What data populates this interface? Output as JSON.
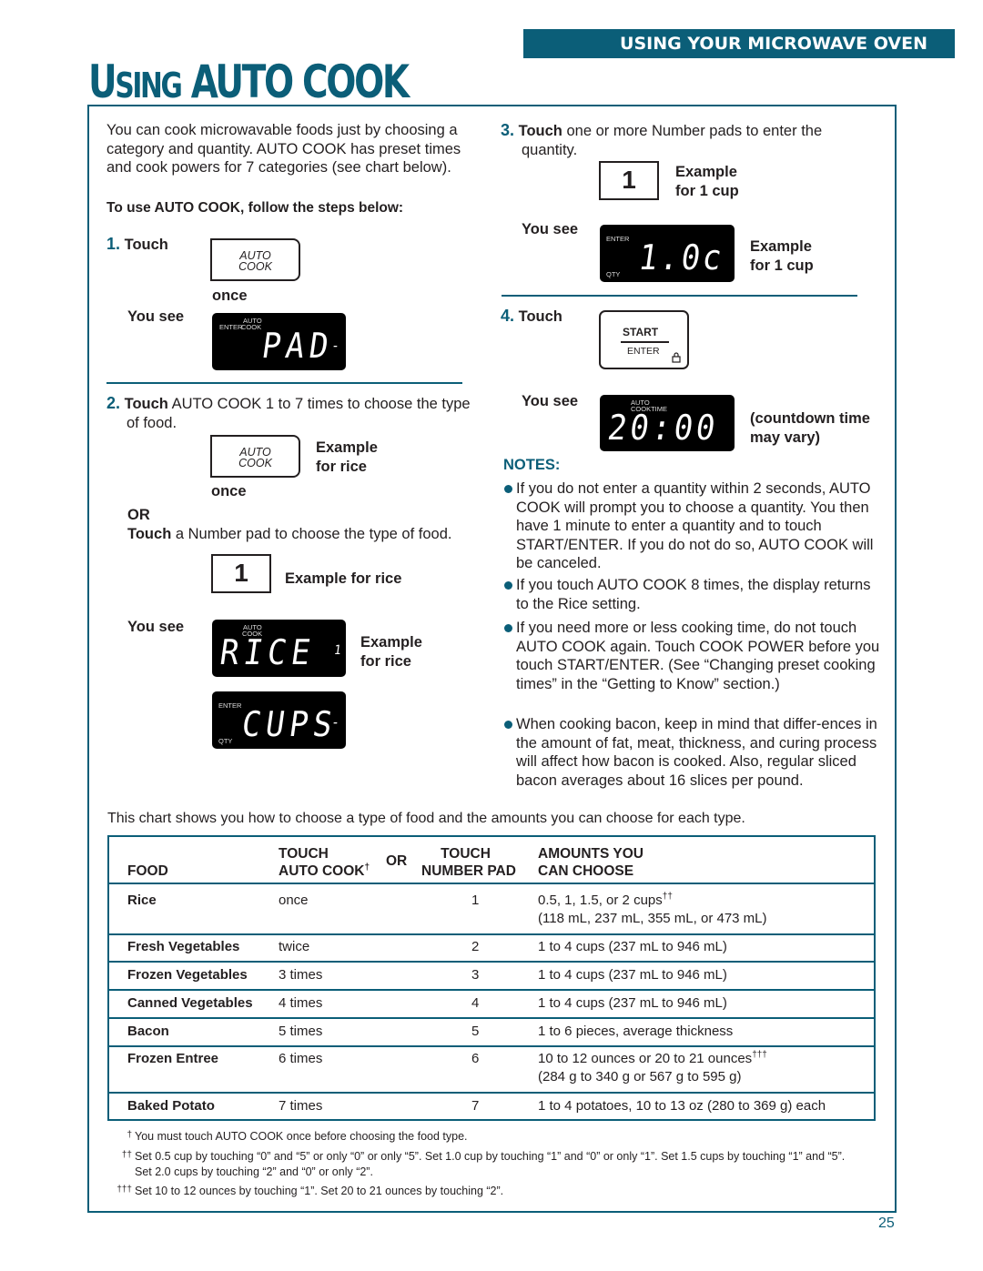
{
  "header": {
    "section_banner": "USING YOUR MICROWAVE OVEN",
    "title_prefix_cap": "U",
    "title_prefix_rest": "SING",
    "title_main": "AUTO COOK"
  },
  "intro": {
    "paragraph": "You can cook microwavable foods just by choosing a category and quantity. AUTO COOK has preset times and cook powers for 7 categories (see chart below).",
    "steps_heading": "To use AUTO COOK, follow the steps below:"
  },
  "step1": {
    "num": "1.",
    "touch_label": "Touch",
    "key_line1": "AUTO",
    "key_line2": "COOK",
    "once": "once",
    "you_see": "You see",
    "display": {
      "label_top": "AUTO",
      "label_left": "ENTER",
      "label_cook": "COOK",
      "text": "PAD",
      "suffix": "-"
    }
  },
  "step2": {
    "num": "2.",
    "touch_label": "Touch",
    "text": " AUTO COOK 1 to 7 times to choose the type of food.",
    "key_line1": "AUTO",
    "key_line2": "COOK",
    "example_line1": "Example",
    "example_line2": "for rice",
    "once": "once",
    "or": "OR",
    "alt_touch": "Touch",
    "alt_text": " a Number pad to choose the type of food.",
    "number_key": "1",
    "number_example": "Example for rice",
    "you_see": "You see",
    "display_rice": {
      "label_auto": "AUTO",
      "label_cook": "COOK",
      "text": "RICE",
      "suffix": "1"
    },
    "display_rice_example_line1": "Example",
    "display_rice_example_line2": "for rice",
    "display_cups": {
      "label_enter": "ENTER",
      "label_qty": "QTY",
      "text": "CUPS",
      "suffix": "-"
    }
  },
  "step3": {
    "num": "3.",
    "touch_label": "Touch",
    "text": " one or more Number pads to enter the quantity.",
    "number_key": "1",
    "example_line1": "Example",
    "example_line2": "for 1 cup",
    "you_see": "You see",
    "display": {
      "label_enter": "ENTER",
      "label_qty": "QTY",
      "text": "1.0c"
    },
    "display_example_line1": "Example",
    "display_example_line2": "for 1 cup"
  },
  "step4": {
    "num": "4.",
    "touch_label": "Touch",
    "key_top": "START",
    "key_bottom": "ENTER",
    "you_see": "You see",
    "display": {
      "label_auto": "AUTO",
      "label_cooktime": "COOKTIME",
      "text": "20:00"
    },
    "note_line1": "(countdown time",
    "note_line2": "may vary)"
  },
  "notes": {
    "heading": "NOTES:",
    "items": [
      "If you do not enter a quantity within 2 seconds, AUTO COOK will prompt you to choose a quantity. You then have 1 minute to enter a quantity and to touch START/ENTER. If you do not do so, AUTO COOK will be canceled.",
      "If you touch AUTO COOK 8 times, the display returns to the Rice setting.",
      "If you need more or less cooking time, do not touch AUTO COOK again. Touch COOK POWER before you touch START/ENTER. (See “Changing preset cooking times” in the “Getting to Know” section.)",
      "When cooking bacon, keep in mind that differ-ences in the amount of fat, meat, thickness, and curing process will affect how bacon is cooked. Also, regular sliced bacon averages about 16 slices per pound."
    ]
  },
  "chart_intro": "This chart shows you how to choose a type of food and the amounts you can choose for each type.",
  "table": {
    "headers": {
      "food": "FOOD",
      "touch_auto_line1": "TOUCH",
      "touch_auto_line2": "AUTO COOK",
      "touch_auto_mark": "†",
      "or": "OR",
      "touch_num_line1": "TOUCH",
      "touch_num_line2": "NUMBER PAD",
      "amounts_line1": "AMOUNTS YOU",
      "amounts_line2": "CAN CHOOSE"
    },
    "rows": [
      {
        "food": "Rice",
        "auto_cook": "once",
        "number_pad": "1",
        "amount_line1": "0.5, 1, 1.5, or 2 cups",
        "amount_mark": "††",
        "amount_line2": "(118 mL, 237 mL, 355 mL, or 473 mL)"
      },
      {
        "food": "Fresh Vegetables",
        "auto_cook": "twice",
        "number_pad": "2",
        "amount_line1": "1 to 4 cups (237 mL to 946 mL)",
        "amount_mark": "",
        "amount_line2": ""
      },
      {
        "food": "Frozen Vegetables",
        "auto_cook": "3 times",
        "number_pad": "3",
        "amount_line1": "1 to 4 cups (237 mL to 946 mL)",
        "amount_mark": "",
        "amount_line2": ""
      },
      {
        "food": "Canned Vegetables",
        "auto_cook": "4 times",
        "number_pad": "4",
        "amount_line1": "1 to 4 cups (237 mL to 946 mL)",
        "amount_mark": "",
        "amount_line2": ""
      },
      {
        "food": "Bacon",
        "auto_cook": "5 times",
        "number_pad": "5",
        "amount_line1": "1 to 6 pieces, average thickness",
        "amount_mark": "",
        "amount_line2": ""
      },
      {
        "food": "Frozen Entree",
        "auto_cook": "6 times",
        "number_pad": "6",
        "amount_line1": "10 to 12 ounces or 20 to 21 ounces",
        "amount_mark": "†††",
        "amount_line2": "(284 g to 340 g or 567 g to 595 g)"
      },
      {
        "food": "Baked Potato",
        "auto_cook": "7 times",
        "number_pad": "7",
        "amount_line1": "1 to 4 potatoes, 10 to 13 oz (280 to 369 g) each",
        "amount_mark": "",
        "amount_line2": ""
      }
    ]
  },
  "footnotes": [
    {
      "mark": "†",
      "text": "You must touch AUTO COOK once before choosing the food type."
    },
    {
      "mark": "††",
      "text": "Set 0.5 cup by touching “0” and “5” or only “0” or only “5”. Set 1.0 cup by touching “1” and “0” or only “1”. Set 1.5 cups by touching “1” and “5”. Set 2.0 cups by touching “2” and “0” or only “2”."
    },
    {
      "mark": "†††",
      "text": "Set 10 to 12 ounces by touching “1”. Set 20 to 21 ounces by touching “2”."
    }
  ],
  "page_number": "25",
  "colors": {
    "accent": "#0b5e78",
    "text": "#231f20",
    "display_bg": "#000000"
  }
}
